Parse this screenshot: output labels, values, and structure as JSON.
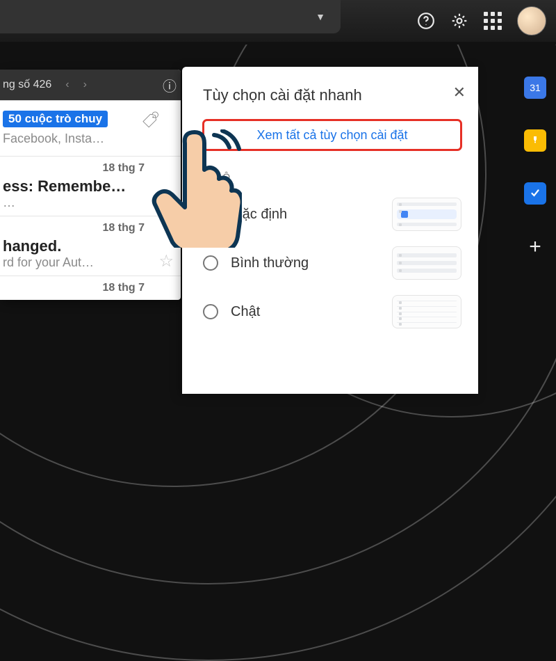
{
  "header": {
    "help_tooltip": "Help",
    "settings_tooltip": "Settings",
    "apps_tooltip": "Google apps"
  },
  "pager": {
    "text": "ng số 426"
  },
  "mail": {
    "row1": {
      "tag": "50 cuộc trò chuy",
      "preview": "Facebook, Insta…"
    },
    "row2": {
      "date": "18 thg 7",
      "subject": "ess: Remembe…",
      "preview": "…"
    },
    "row3": {
      "date": "18 thg 7",
      "subject": "hanged.",
      "preview": "rd for your Aut…"
    },
    "row4": {
      "date": "18 thg 7"
    }
  },
  "panel": {
    "title": "Tùy chọn cài đặt nhanh",
    "see_all": "Xem tất cả tùy chọn cài đặt",
    "density_label": "T ĐỘ",
    "density": {
      "default": "Mặc định",
      "normal": "Bình thường",
      "compact": "Chật"
    }
  },
  "rail": {
    "calendar_day": "31"
  }
}
